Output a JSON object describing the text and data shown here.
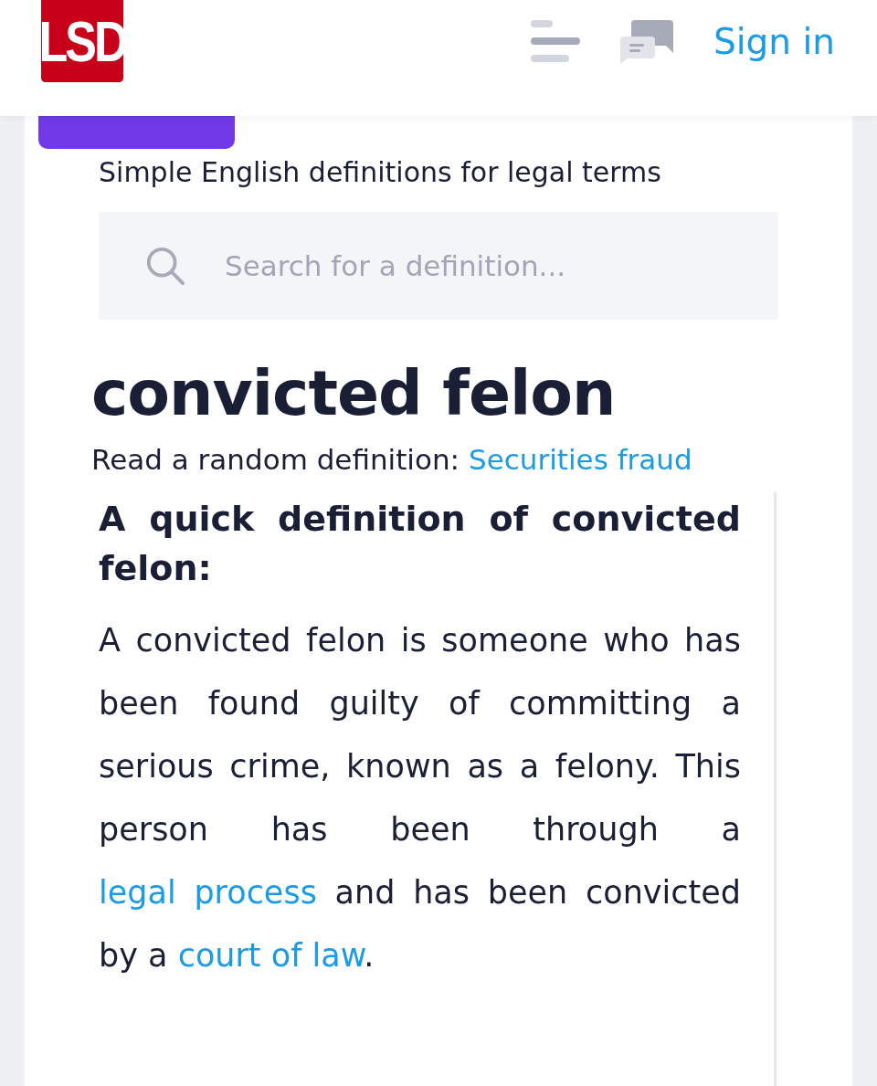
{
  "header": {
    "logo": "LSD",
    "sign_in": "Sign in"
  },
  "tagline": "Simple English definitions for legal terms",
  "search": {
    "placeholder": "Search for a definition..."
  },
  "term": "convicted felon",
  "random": {
    "label": "Read a random definition:",
    "link": "Securities fraud"
  },
  "definition": {
    "heading": "A quick definition of convicted felon:",
    "body": [
      {
        "kind": "text",
        "text": "A convicted felon is someone who has been found guilty of committing a serious crime, known as a felony. This person has been through a "
      },
      {
        "kind": "link",
        "text": "legal process"
      },
      {
        "kind": "text",
        "text": " and has been convicted by a "
      },
      {
        "kind": "link",
        "text": "court of law"
      },
      {
        "kind": "text",
        "text": "."
      }
    ]
  }
}
